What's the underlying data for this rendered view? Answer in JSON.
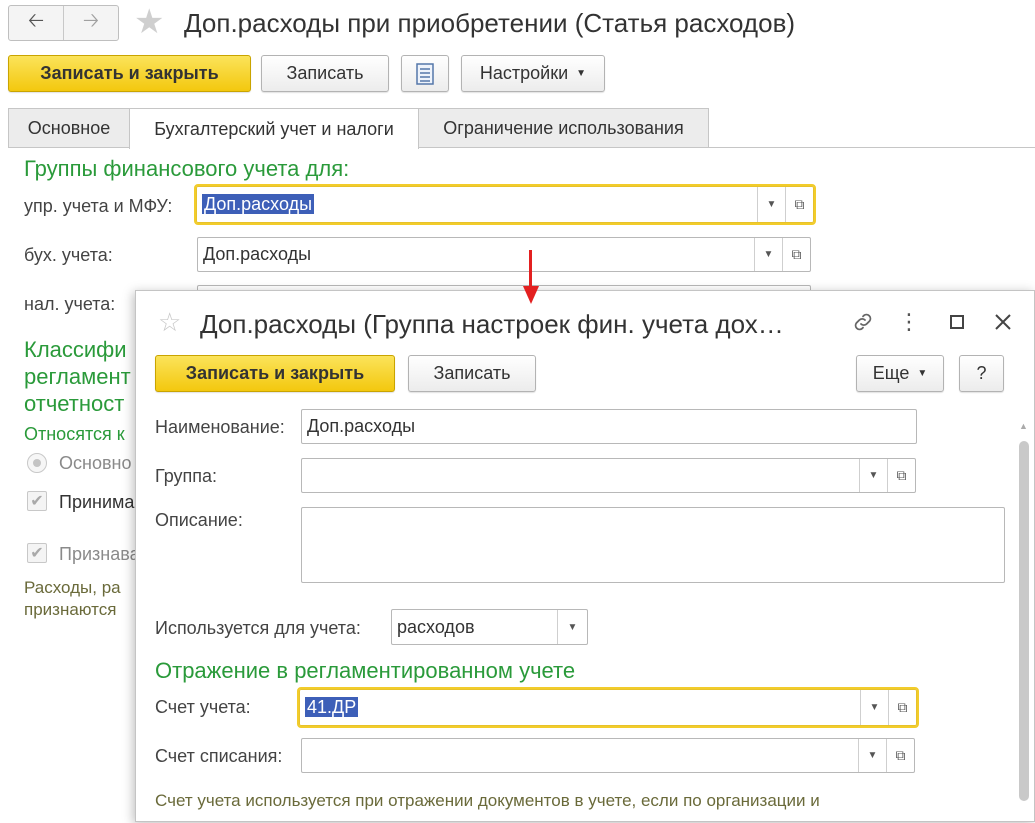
{
  "window": {
    "title": "Доп.расходы при приобретении (Статья расходов)",
    "toolbar": {
      "save_close": "Записать и закрыть",
      "save": "Записать",
      "settings": "Настройки"
    },
    "tabs": [
      "Основное",
      "Бухгалтерский учет и налоги",
      "Ограничение использования"
    ],
    "section_groups": "Группы финансового учета для:",
    "fields": {
      "upr_label": "упр. учета и МФУ:",
      "upr_value": "Доп.расходы",
      "buh_label": "бух. учета:",
      "buh_value": "Доп.расходы",
      "nal_label": "нал. учета:"
    },
    "classif_lines": [
      "Классифи",
      "регламент",
      "отчетност"
    ],
    "relates_to": "Относятся к",
    "option_main": "Основно",
    "check_accept": "Принима",
    "check_recognize": "Признава",
    "note_lines": [
      "Расходы, ра",
      "признаются"
    ]
  },
  "dialog": {
    "title": "Доп.расходы (Группа настроек фин. учета дох…",
    "toolbar": {
      "save_close": "Записать и закрыть",
      "save": "Записать",
      "more": "Еще",
      "help": "?"
    },
    "fields": {
      "name_label": "Наименование:",
      "name_value": "Доп.расходы",
      "group_label": "Группа:",
      "group_value": "",
      "desc_label": "Описание:",
      "desc_value": "",
      "used_for_label": "Используется для учета:",
      "used_for_value": "расходов",
      "section_regl": "Отражение в регламентированном учете",
      "account_label": "Счет учета:",
      "account_value": "41.ДР",
      "writeoff_label": "Счет списания:",
      "writeoff_value": ""
    },
    "hint": "Счет учета используется при отражении документов в учете, если по организации и"
  },
  "colors": {
    "accent_yellow": "#f3c80e",
    "section_green": "#2a9a3a",
    "selection_blue": "#3d5fb8",
    "arrow_red": "#e32020"
  }
}
